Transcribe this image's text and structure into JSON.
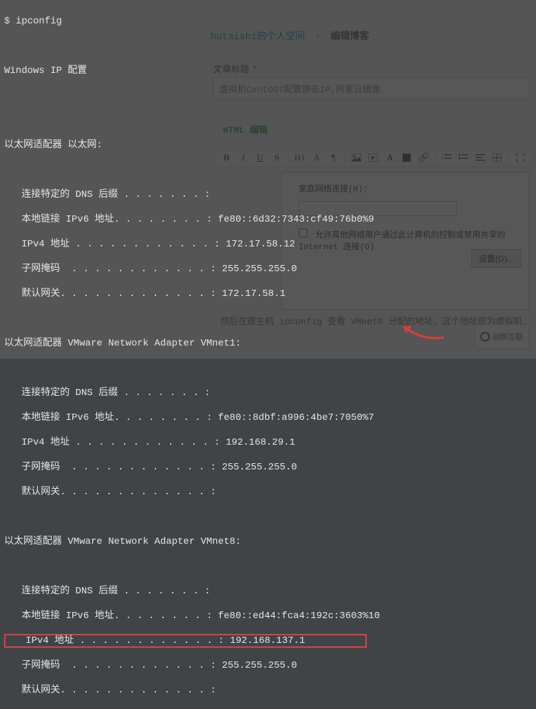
{
  "terminal": {
    "prompt": "$ ",
    "command": "ipconfig",
    "title": "Windows IP 配置",
    "adapters": [
      {
        "header": "以太网适配器 以太网:",
        "fields": [
          {
            "label": "连接特定的 DNS 后缀",
            "value": ""
          },
          {
            "label": "本地链接 IPv6 地址",
            "value": "fe80::6d32:7343:cf49:76b0%9"
          },
          {
            "label": "IPv4 地址",
            "value": "172.17.58.12"
          },
          {
            "label": "子网掩码",
            "value": "255.255.255.0"
          },
          {
            "label": "默认网关",
            "value": "172.17.58.1"
          }
        ]
      },
      {
        "header": "以太网适配器 VMware Network Adapter VMnet1:",
        "fields": [
          {
            "label": "连接特定的 DNS 后缀",
            "value": ""
          },
          {
            "label": "本地链接 IPv6 地址",
            "value": "fe80::8dbf:a996:4be7:7050%7"
          },
          {
            "label": "IPv4 地址",
            "value": "192.168.29.1"
          },
          {
            "label": "子网掩码",
            "value": "255.255.255.0"
          },
          {
            "label": "默认网关",
            "value": ""
          }
        ]
      },
      {
        "header": "以太网适配器 VMware Network Adapter VMnet8:",
        "fields": [
          {
            "label": "连接特定的 DNS 后缀",
            "value": ""
          },
          {
            "label": "本地链接 IPv6 地址",
            "value": "fe80::ed44:fca4:192c:3603%10"
          },
          {
            "label": "IPv4 地址",
            "value": "192.168.137.1",
            "highlight": true
          },
          {
            "label": "子网掩码",
            "value": "255.255.255.0"
          },
          {
            "label": "默认网关",
            "value": ""
          }
        ]
      }
    ]
  },
  "page": {
    "breadcrumb": {
      "user": "hutaishi",
      "suffix": "的个人空间",
      "current": "编辑博客"
    },
    "title_label": "文章标题",
    "title_value": "虚拟机CentOS7配置静态IP,阿里云镜像",
    "editor_label": "HTML 编辑",
    "toolbar": {
      "bold": "B",
      "italic": "I",
      "underline": "U",
      "strike": "S"
    },
    "panel": {
      "home_label": "家庭网络连接(H):",
      "share_label": "允许其他网络用户通过此计算机的控制或禁用共享的 Internet 连接(O)",
      "settings_btn": "设置(G)..."
    },
    "footer": "然后在宿主机 ipconfig 查看 VMnet8 分配的地址，这个地址即为虚拟机",
    "logo": "创新互联"
  }
}
